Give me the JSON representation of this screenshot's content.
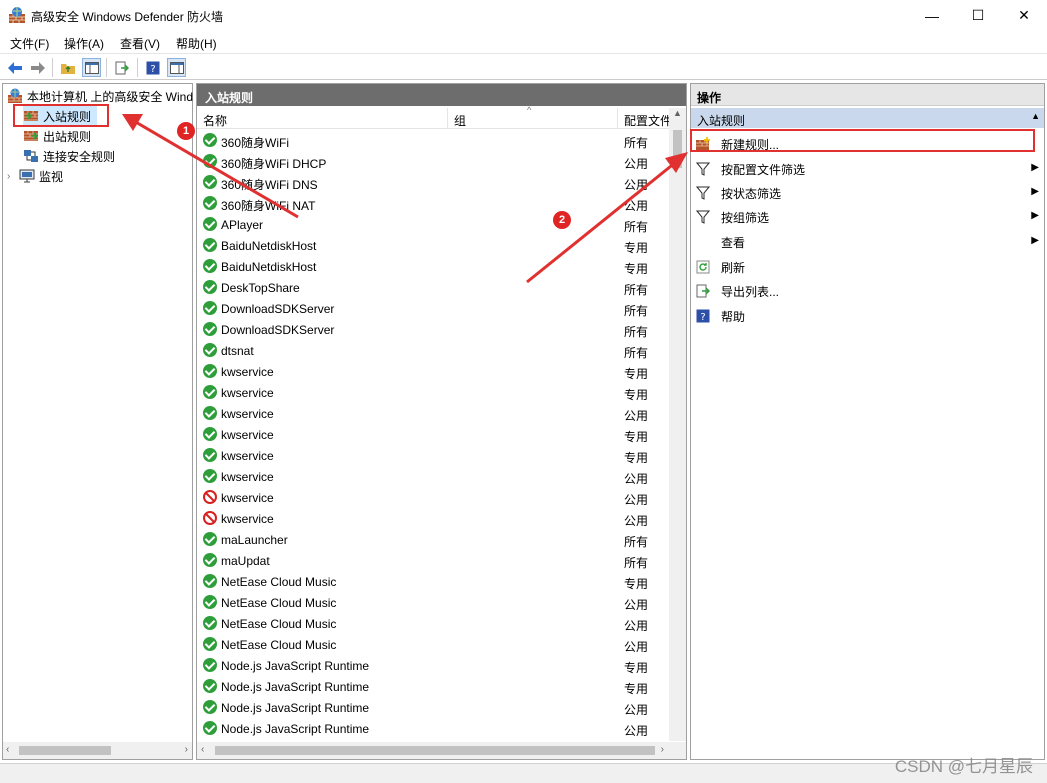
{
  "window": {
    "title": "高级安全 Windows Defender 防火墙",
    "minimize": "—",
    "maximize": "☐",
    "close": "✕"
  },
  "menu": [
    "文件(F)",
    "操作(A)",
    "查看(V)",
    "帮助(H)"
  ],
  "tree": {
    "root": "本地计算机 上的高级安全 Wind",
    "items": [
      "入站规则",
      "出站规则",
      "连接安全规则",
      "监视"
    ]
  },
  "center": {
    "header": "入站规则",
    "columns": [
      "名称",
      "组",
      "配置文件"
    ],
    "rows": [
      {
        "name": "360随身WiFi",
        "profile": "所有",
        "status": "allow"
      },
      {
        "name": "360随身WiFi DHCP",
        "profile": "公用",
        "status": "allow"
      },
      {
        "name": "360随身WiFi DNS",
        "profile": "公用",
        "status": "allow"
      },
      {
        "name": "360随身WiFi NAT",
        "profile": "公用",
        "status": "allow"
      },
      {
        "name": "APlayer",
        "profile": "所有",
        "status": "allow"
      },
      {
        "name": "BaiduNetdiskHost",
        "profile": "专用",
        "status": "allow"
      },
      {
        "name": "BaiduNetdiskHost",
        "profile": "专用",
        "status": "allow"
      },
      {
        "name": "DeskTopShare",
        "profile": "所有",
        "status": "allow"
      },
      {
        "name": "DownloadSDKServer",
        "profile": "所有",
        "status": "allow"
      },
      {
        "name": "DownloadSDKServer",
        "profile": "所有",
        "status": "allow"
      },
      {
        "name": "dtsnat",
        "profile": "所有",
        "status": "allow"
      },
      {
        "name": "kwservice",
        "profile": "专用",
        "status": "allow"
      },
      {
        "name": "kwservice",
        "profile": "专用",
        "status": "allow"
      },
      {
        "name": "kwservice",
        "profile": "公用",
        "status": "allow"
      },
      {
        "name": "kwservice",
        "profile": "专用",
        "status": "allow"
      },
      {
        "name": "kwservice",
        "profile": "专用",
        "status": "allow"
      },
      {
        "name": "kwservice",
        "profile": "公用",
        "status": "allow"
      },
      {
        "name": "kwservice",
        "profile": "公用",
        "status": "block"
      },
      {
        "name": "kwservice",
        "profile": "公用",
        "status": "block"
      },
      {
        "name": "maLauncher",
        "profile": "所有",
        "status": "allow"
      },
      {
        "name": "maUpdat",
        "profile": "所有",
        "status": "allow"
      },
      {
        "name": "NetEase Cloud Music",
        "profile": "专用",
        "status": "allow"
      },
      {
        "name": "NetEase Cloud Music",
        "profile": "公用",
        "status": "allow"
      },
      {
        "name": "NetEase Cloud Music",
        "profile": "公用",
        "status": "allow"
      },
      {
        "name": "NetEase Cloud Music",
        "profile": "公用",
        "status": "allow"
      },
      {
        "name": "Node.js JavaScript Runtime",
        "profile": "专用",
        "status": "allow"
      },
      {
        "name": "Node.js JavaScript Runtime",
        "profile": "专用",
        "status": "allow"
      },
      {
        "name": "Node.js JavaScript Runtime",
        "profile": "公用",
        "status": "allow"
      },
      {
        "name": "Node.js JavaScript Runtime",
        "profile": "公用",
        "status": "allow"
      }
    ]
  },
  "actions": {
    "header": "操作",
    "section": "入站规则",
    "items": [
      {
        "label": "新建规则...",
        "icon": "new-rule-icon",
        "submenu": false
      },
      {
        "label": "按配置文件筛选",
        "icon": "filter-icon",
        "submenu": true
      },
      {
        "label": "按状态筛选",
        "icon": "filter-icon",
        "submenu": true
      },
      {
        "label": "按组筛选",
        "icon": "filter-icon",
        "submenu": true
      },
      {
        "label": "查看",
        "icon": "",
        "submenu": true
      },
      {
        "label": "刷新",
        "icon": "refresh-icon",
        "submenu": false
      },
      {
        "label": "导出列表...",
        "icon": "export-icon",
        "submenu": false
      },
      {
        "label": "帮助",
        "icon": "help-icon",
        "submenu": false
      }
    ]
  },
  "annotations": {
    "step1": "1",
    "step2": "2"
  },
  "watermark": "CSDN @七月星辰",
  "colors": {
    "allow": "#2e9e3a",
    "block": "#d82020",
    "annotation": "#e03030",
    "header": "#6d6d6d",
    "section": "#c9d8ec"
  }
}
